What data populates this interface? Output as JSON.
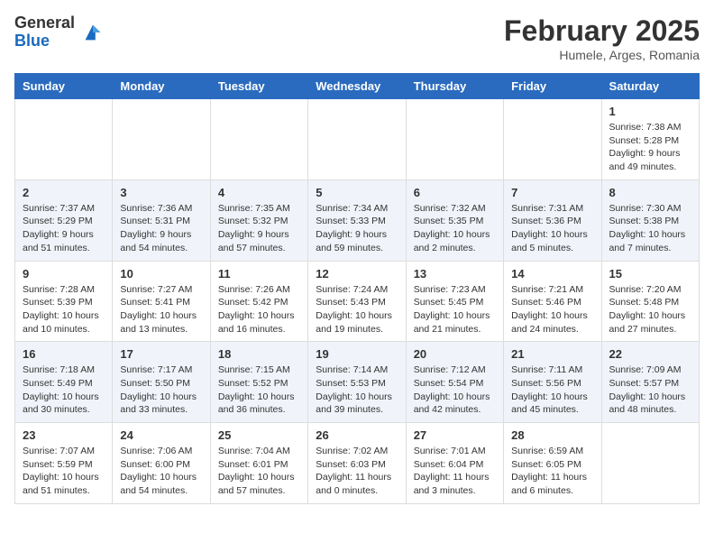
{
  "logo": {
    "general": "General",
    "blue": "Blue"
  },
  "title": {
    "month_year": "February 2025",
    "location": "Humele, Arges, Romania"
  },
  "weekdays": [
    "Sunday",
    "Monday",
    "Tuesday",
    "Wednesday",
    "Thursday",
    "Friday",
    "Saturday"
  ],
  "weeks": [
    [
      {
        "day": "",
        "info": ""
      },
      {
        "day": "",
        "info": ""
      },
      {
        "day": "",
        "info": ""
      },
      {
        "day": "",
        "info": ""
      },
      {
        "day": "",
        "info": ""
      },
      {
        "day": "",
        "info": ""
      },
      {
        "day": "1",
        "info": "Sunrise: 7:38 AM\nSunset: 5:28 PM\nDaylight: 9 hours and 49 minutes."
      }
    ],
    [
      {
        "day": "2",
        "info": "Sunrise: 7:37 AM\nSunset: 5:29 PM\nDaylight: 9 hours and 51 minutes."
      },
      {
        "day": "3",
        "info": "Sunrise: 7:36 AM\nSunset: 5:31 PM\nDaylight: 9 hours and 54 minutes."
      },
      {
        "day": "4",
        "info": "Sunrise: 7:35 AM\nSunset: 5:32 PM\nDaylight: 9 hours and 57 minutes."
      },
      {
        "day": "5",
        "info": "Sunrise: 7:34 AM\nSunset: 5:33 PM\nDaylight: 9 hours and 59 minutes."
      },
      {
        "day": "6",
        "info": "Sunrise: 7:32 AM\nSunset: 5:35 PM\nDaylight: 10 hours and 2 minutes."
      },
      {
        "day": "7",
        "info": "Sunrise: 7:31 AM\nSunset: 5:36 PM\nDaylight: 10 hours and 5 minutes."
      },
      {
        "day": "8",
        "info": "Sunrise: 7:30 AM\nSunset: 5:38 PM\nDaylight: 10 hours and 7 minutes."
      }
    ],
    [
      {
        "day": "9",
        "info": "Sunrise: 7:28 AM\nSunset: 5:39 PM\nDaylight: 10 hours and 10 minutes."
      },
      {
        "day": "10",
        "info": "Sunrise: 7:27 AM\nSunset: 5:41 PM\nDaylight: 10 hours and 13 minutes."
      },
      {
        "day": "11",
        "info": "Sunrise: 7:26 AM\nSunset: 5:42 PM\nDaylight: 10 hours and 16 minutes."
      },
      {
        "day": "12",
        "info": "Sunrise: 7:24 AM\nSunset: 5:43 PM\nDaylight: 10 hours and 19 minutes."
      },
      {
        "day": "13",
        "info": "Sunrise: 7:23 AM\nSunset: 5:45 PM\nDaylight: 10 hours and 21 minutes."
      },
      {
        "day": "14",
        "info": "Sunrise: 7:21 AM\nSunset: 5:46 PM\nDaylight: 10 hours and 24 minutes."
      },
      {
        "day": "15",
        "info": "Sunrise: 7:20 AM\nSunset: 5:48 PM\nDaylight: 10 hours and 27 minutes."
      }
    ],
    [
      {
        "day": "16",
        "info": "Sunrise: 7:18 AM\nSunset: 5:49 PM\nDaylight: 10 hours and 30 minutes."
      },
      {
        "day": "17",
        "info": "Sunrise: 7:17 AM\nSunset: 5:50 PM\nDaylight: 10 hours and 33 minutes."
      },
      {
        "day": "18",
        "info": "Sunrise: 7:15 AM\nSunset: 5:52 PM\nDaylight: 10 hours and 36 minutes."
      },
      {
        "day": "19",
        "info": "Sunrise: 7:14 AM\nSunset: 5:53 PM\nDaylight: 10 hours and 39 minutes."
      },
      {
        "day": "20",
        "info": "Sunrise: 7:12 AM\nSunset: 5:54 PM\nDaylight: 10 hours and 42 minutes."
      },
      {
        "day": "21",
        "info": "Sunrise: 7:11 AM\nSunset: 5:56 PM\nDaylight: 10 hours and 45 minutes."
      },
      {
        "day": "22",
        "info": "Sunrise: 7:09 AM\nSunset: 5:57 PM\nDaylight: 10 hours and 48 minutes."
      }
    ],
    [
      {
        "day": "23",
        "info": "Sunrise: 7:07 AM\nSunset: 5:59 PM\nDaylight: 10 hours and 51 minutes."
      },
      {
        "day": "24",
        "info": "Sunrise: 7:06 AM\nSunset: 6:00 PM\nDaylight: 10 hours and 54 minutes."
      },
      {
        "day": "25",
        "info": "Sunrise: 7:04 AM\nSunset: 6:01 PM\nDaylight: 10 hours and 57 minutes."
      },
      {
        "day": "26",
        "info": "Sunrise: 7:02 AM\nSunset: 6:03 PM\nDaylight: 11 hours and 0 minutes."
      },
      {
        "day": "27",
        "info": "Sunrise: 7:01 AM\nSunset: 6:04 PM\nDaylight: 11 hours and 3 minutes."
      },
      {
        "day": "28",
        "info": "Sunrise: 6:59 AM\nSunset: 6:05 PM\nDaylight: 11 hours and 6 minutes."
      },
      {
        "day": "",
        "info": ""
      }
    ]
  ]
}
